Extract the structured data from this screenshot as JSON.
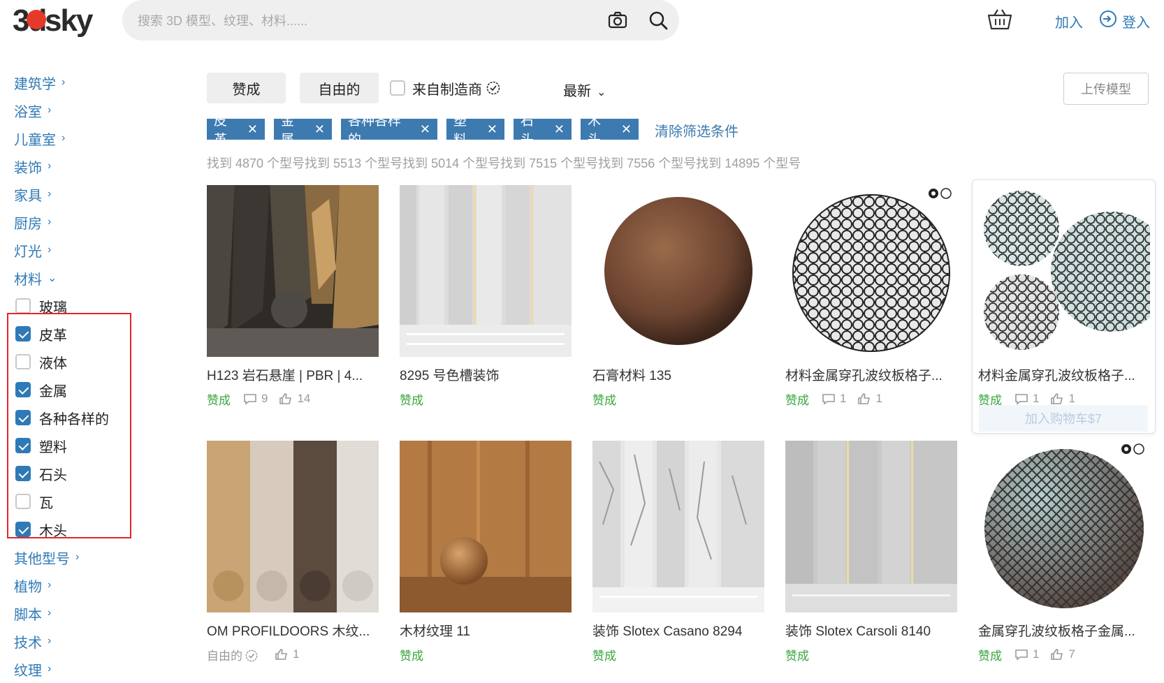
{
  "header": {
    "logo_text_3d": "3d",
    "logo_text_sky": "sky",
    "search_placeholder": "搜索 3D 模型、纹理、材料......",
    "join": "加入",
    "login": "登入"
  },
  "sidebar": {
    "categories_top": [
      {
        "label": "建筑学"
      },
      {
        "label": "浴室"
      },
      {
        "label": "儿童室"
      },
      {
        "label": "装饰"
      },
      {
        "label": "家具"
      },
      {
        "label": "厨房"
      },
      {
        "label": "灯光"
      }
    ],
    "open_category": {
      "label": "材料"
    },
    "materials": [
      {
        "label": "玻璃",
        "checked": false
      },
      {
        "label": "皮革",
        "checked": true
      },
      {
        "label": "液体",
        "checked": false
      },
      {
        "label": "金属",
        "checked": true
      },
      {
        "label": "各种各样的",
        "checked": true
      },
      {
        "label": "塑料",
        "checked": true
      },
      {
        "label": "石头",
        "checked": true
      },
      {
        "label": "瓦",
        "checked": false
      },
      {
        "label": "木头",
        "checked": true
      }
    ],
    "categories_bottom": [
      {
        "label": "其他型号"
      },
      {
        "label": "植物"
      },
      {
        "label": "脚本"
      },
      {
        "label": "技术"
      },
      {
        "label": "纹理"
      }
    ]
  },
  "filters": {
    "pro": "赞成",
    "free": "自由的",
    "from_maker": "来自制造商",
    "sort": "最新",
    "upload": "上传模型",
    "tags": [
      "皮革",
      "金属",
      "各种各样的",
      "塑料",
      "石头",
      "木头"
    ],
    "clear": "清除筛选条件",
    "found": "找到 4870 个型号找到 5513 个型号找到 5014 个型号找到 7515 个型号找到 7556 个型号找到 14895 个型号"
  },
  "cards": [
    {
      "title": "H123 岩石悬崖 | PBR | 4...",
      "cost": "赞成",
      "comments": "9",
      "likes": "14"
    },
    {
      "title": "8295 号色槽装饰",
      "cost": "赞成",
      "comments": "",
      "likes": ""
    },
    {
      "title": "石膏材料 135",
      "cost": "赞成",
      "comments": "",
      "likes": ""
    },
    {
      "title": "材料金属穿孔波纹板格子...",
      "cost": "赞成",
      "comments": "1",
      "likes": "1"
    },
    {
      "title": "材料金属穿孔波纹板格子...",
      "cost": "赞成",
      "comments": "1",
      "likes": "1",
      "add_to_cart": "加入购物车$7"
    },
    {
      "title": "OM PROFILDOORS 木纹...",
      "cost": "自由的",
      "comments": "",
      "likes": "1"
    },
    {
      "title": "木材纹理 11",
      "cost": "赞成",
      "comments": "",
      "likes": ""
    },
    {
      "title": "装饰 Slotex Casano 8294",
      "cost": "赞成",
      "comments": "",
      "likes": ""
    },
    {
      "title": "装饰 Slotex Carsoli 8140",
      "cost": "赞成",
      "comments": "",
      "likes": ""
    },
    {
      "title": "金属穿孔波纹板格子金属...",
      "cost": "赞成",
      "comments": "1",
      "likes": "7"
    }
  ],
  "colors": {
    "accent": "#2f7ab6",
    "tag": "#3d7ab0",
    "pro_green": "#3aa640",
    "highlight": "#e3262a"
  }
}
